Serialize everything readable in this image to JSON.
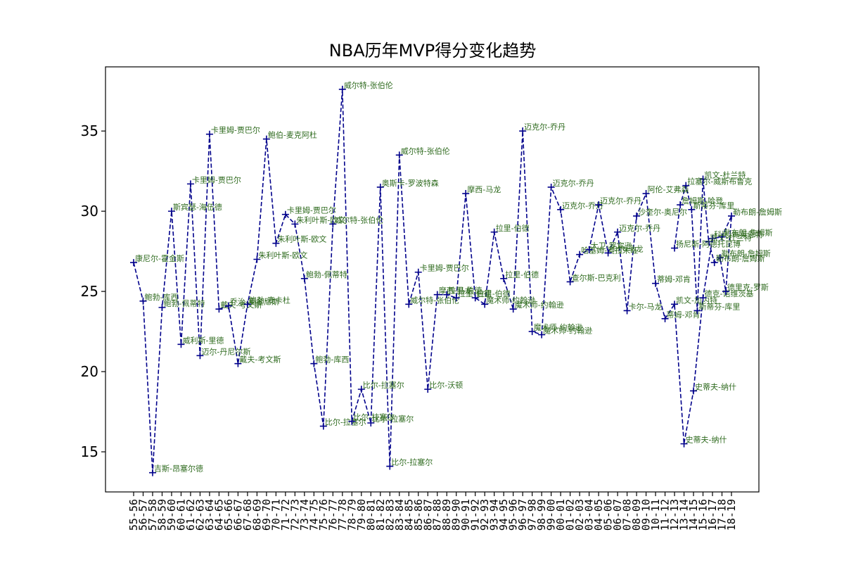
{
  "chart_data": {
    "type": "line",
    "title": "NBA历年MVP得分变化趋势",
    "xlabel": "",
    "ylabel": "",
    "ylim": [
      12.5,
      39
    ],
    "yticks": [
      15,
      20,
      25,
      30,
      35
    ],
    "grid": false,
    "line_style": "dashed",
    "marker": "+",
    "colors": {
      "line": "#00008b",
      "label": "#2f6b1f"
    },
    "categories": [
      "55-56",
      "56-57",
      "57-58",
      "58-59",
      "59-60",
      "60-61",
      "61-62",
      "62-63",
      "63-64",
      "64-65",
      "65-66",
      "66-67",
      "67-68",
      "68-69",
      "69-70",
      "70-71",
      "71-72",
      "72-73",
      "73-74",
      "74-75",
      "75-76",
      "76-77",
      "77-78",
      "78-79",
      "79-80",
      "80-81",
      "81-82",
      "82-83",
      "83-84",
      "84-85",
      "85-86",
      "86-87",
      "87-88",
      "88-89",
      "89-90",
      "90-91",
      "91-92",
      "92-93",
      "93-94",
      "94-95",
      "95-96",
      "96-97",
      "97-98",
      "98-99",
      "99-00",
      "00-01",
      "01-02",
      "02-03",
      "03-04",
      "04-05",
      "05-06",
      "06-07",
      "07-08",
      "08-09",
      "09-10",
      "10-11",
      "11-12",
      "12-13",
      "13-14",
      "14-15",
      "15-16",
      "16-17",
      "17-18",
      "18-19"
    ],
    "points": [
      {
        "x": "55-56",
        "y": 26.8,
        "label": "康尼尔-霍金斯"
      },
      {
        "x": "56-57",
        "y": 24.4,
        "label": "鲍勃-库西"
      },
      {
        "x": "57-58",
        "y": 13.7,
        "label": "吉斯-昂塞尔德"
      },
      {
        "x": "58-59",
        "y": 24.0,
        "label": "鲍勃-佩蒂特"
      },
      {
        "x": "59-60",
        "y": 30.0,
        "label": "斯宾瑟-海伍德"
      },
      {
        "x": "60-61",
        "y": 21.7,
        "label": "威利斯-里德"
      },
      {
        "x": "61-62",
        "y": 31.7,
        "label": "卡里姆-贾巴尔"
      },
      {
        "x": "62-63",
        "y": 21.0,
        "label": "迈尔-丹尼尔斯"
      },
      {
        "x": "63-64",
        "y": 34.8,
        "label": "卡里姆-贾巴尔"
      },
      {
        "x": "64-65",
        "y": 23.9,
        "label": "戴夫-考文斯"
      },
      {
        "x": "65-66",
        "y": 24.1,
        "label": "乔治-麦金尼斯"
      },
      {
        "x": "66-67",
        "y": 20.5,
        "label": "戴夫-考文斯"
      },
      {
        "x": "67-68",
        "y": 24.2,
        "label": "鲍勃-麦卡杜"
      },
      {
        "x": "68-69",
        "y": 27.0,
        "label": "朱利叶斯-欧文"
      },
      {
        "x": "69-70",
        "y": 34.5,
        "label": "鲍伯-麦克阿杜"
      },
      {
        "x": "70-71",
        "y": 28.0,
        "label": "朱利叶斯-欧文"
      },
      {
        "x": "71-72",
        "y": 29.8,
        "label": "卡里姆-贾巴尔"
      },
      {
        "x": "72-73",
        "y": 29.2,
        "label": "朱利叶斯-欧文"
      },
      {
        "x": "73-74",
        "y": 25.8,
        "label": "鲍勃-佩蒂特"
      },
      {
        "x": "74-75",
        "y": 20.5,
        "label": "鲍勃-库西"
      },
      {
        "x": "75-76",
        "y": 16.6,
        "label": "比尔-拉塞尔"
      },
      {
        "x": "76-77",
        "y": 29.2,
        "label": "威尔特-张伯伦"
      },
      {
        "x": "77-78",
        "y": 37.6,
        "label": "威尔特-张伯伦"
      },
      {
        "x": "78-79",
        "y": 16.9,
        "label": "比尔-拉塞尔"
      },
      {
        "x": "79-80",
        "y": 18.9,
        "label": "比尔-拉塞尔"
      },
      {
        "x": "80-81",
        "y": 16.8,
        "label": "比尔-拉塞尔"
      },
      {
        "x": "81-82",
        "y": 31.5,
        "label": "奥斯卡-罗波特森"
      },
      {
        "x": "82-83",
        "y": 14.1,
        "label": "比尔-拉塞尔"
      },
      {
        "x": "83-84",
        "y": 33.5,
        "label": "威尔特-张伯伦"
      },
      {
        "x": "84-85",
        "y": 24.2,
        "label": "威尔特-张伯伦"
      },
      {
        "x": "85-86",
        "y": 26.2,
        "label": "卡里姆-贾巴尔"
      },
      {
        "x": "86-87",
        "y": 18.9,
        "label": "比尔-沃顿"
      },
      {
        "x": "87-88",
        "y": 24.8,
        "label": "摩西-马龙"
      },
      {
        "x": "88-89",
        "y": 24.8,
        "label": "拉里-伯德"
      },
      {
        "x": "89-90",
        "y": 24.6,
        "label": "拉里-伯德"
      },
      {
        "x": "90-91",
        "y": 31.1,
        "label": "摩西-马龙"
      },
      {
        "x": "91-92",
        "y": 24.6,
        "label": "拉里-伯德"
      },
      {
        "x": "92-93",
        "y": 24.2,
        "label": "魔术师-约翰逊"
      },
      {
        "x": "93-94",
        "y": 28.7,
        "label": "拉里-伯德"
      },
      {
        "x": "94-95",
        "y": 25.8,
        "label": "拉里-伯德"
      },
      {
        "x": "95-96",
        "y": 23.9,
        "label": "魔术师-约翰逊"
      },
      {
        "x": "96-97",
        "y": 35.0,
        "label": "迈克尔-乔丹"
      },
      {
        "x": "97-98",
        "y": 22.5,
        "label": "魔术师-约翰逊"
      },
      {
        "x": "98-99",
        "y": 22.3,
        "label": "魔术师-约翰逊"
      },
      {
        "x": "99-00",
        "y": 31.5,
        "label": "迈克尔-乔丹"
      },
      {
        "x": "00-01",
        "y": 30.1,
        "label": "迈克尔-乔丹"
      },
      {
        "x": "01-02",
        "y": 25.6,
        "label": "查尔斯-巴克利"
      },
      {
        "x": "02-03",
        "y": 27.3,
        "label": "哈基姆-奥拉朱旺"
      },
      {
        "x": "03-04",
        "y": 27.6,
        "label": "大卫-罗宾逊"
      },
      {
        "x": "04-05",
        "y": 30.4,
        "label": "迈克尔-乔丹"
      },
      {
        "x": "05-06",
        "y": 27.4,
        "label": "卡尔-马龙"
      },
      {
        "x": "06-07",
        "y": 28.7,
        "label": "迈克尔-乔丹"
      },
      {
        "x": "07-08",
        "y": 23.8,
        "label": "卡尔-马龙"
      },
      {
        "x": "08-09",
        "y": 29.7,
        "label": "沙奎尔-奥尼尔"
      },
      {
        "x": "09-10",
        "y": 31.1,
        "label": "阿伦-艾弗森"
      },
      {
        "x": "10-11",
        "y": 25.5,
        "label": "蒂姆-邓肯"
      },
      {
        "x": "11-12",
        "y": 23.3,
        "label": "蒂姆-邓肯"
      },
      {
        "x": "12-13",
        "y": 24.2,
        "label": "凯文-加内特"
      },
      {
        "x": "13-14",
        "y": 15.5,
        "label": "史蒂夫-纳什"
      },
      {
        "x": "14-15",
        "y": 18.8,
        "label": "史蒂夫-纳什"
      },
      {
        "x": "15-16",
        "y": 24.6,
        "label": "德克-诺维茨基"
      },
      {
        "x": "16-17",
        "y": 28.3,
        "label": "科比-布莱恩特"
      },
      {
        "x": "17-18",
        "y": 28.4,
        "label": "勒布朗-詹姆斯"
      },
      {
        "x": "18-19",
        "y": 29.7,
        "label": "勒布朗-詹姆斯"
      },
      {
        "x": "18-19",
        "y": 25.0,
        "label": "德里克-罗斯"
      },
      {
        "x": "18-19",
        "y": 27.1,
        "label": "勒布朗-詹姆斯"
      },
      {
        "x": "18-19",
        "y": 26.8,
        "label": "勒布朗-詹姆斯"
      },
      {
        "x": "18-19",
        "y": 28.1,
        "label": "凯文-杜兰特"
      },
      {
        "x": "18-19",
        "y": 32.0,
        "label": "凯文-杜兰特"
      },
      {
        "x": "18-19",
        "y": 23.8,
        "label": "斯蒂芬-库里"
      },
      {
        "x": "18-19",
        "y": 30.1,
        "label": "斯蒂芬-库里"
      },
      {
        "x": "18-19",
        "y": 31.6,
        "label": "拉塞尔-威斯布鲁克"
      },
      {
        "x": "18-19",
        "y": 30.4,
        "label": "詹姆斯-哈登"
      },
      {
        "x": "18-19",
        "y": 27.7,
        "label": "扬尼斯-阿德托昆博"
      }
    ]
  }
}
